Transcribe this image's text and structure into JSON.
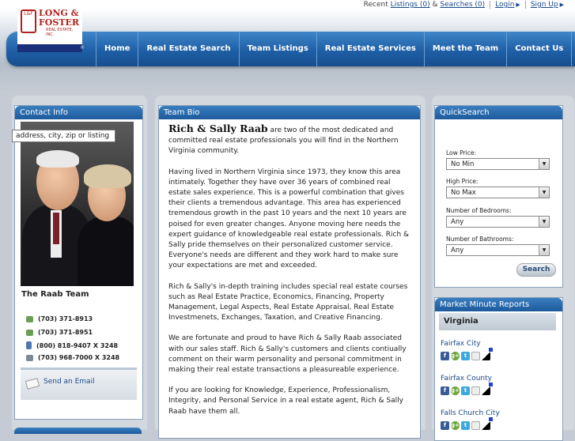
{
  "header": {
    "top_links": {
      "recent_label": "Recent",
      "listings": "Listings (0)",
      "amp": "&",
      "searches": "Searches (0)",
      "login": "Login",
      "signup": "Sign Up"
    },
    "logo": {
      "line1": "LONG &",
      "line2": "FOSTER",
      "line3": "REAL ESTATE, INC.",
      "seal": "L&F",
      "registered": "®"
    },
    "nav": [
      "Home",
      "Real Estate Search",
      "Team Listings",
      "Real Estate Services",
      "Meet the Team",
      "Contact Us"
    ]
  },
  "contact": {
    "title": "Contact Info",
    "team_name": "The Raab Team",
    "phones": [
      "(703) 371-8913",
      "(703) 371-8951",
      "(800) 818-9407 X 3248",
      "(703) 968-7000 X 3248"
    ],
    "email_link": "Send an Email"
  },
  "bio": {
    "title": "Team Bio",
    "name": "Rich & Sally Raab",
    "intro_rest": " are two of the most dedicated and committed real estate professionals you will find in the Northern Virginia community.",
    "paragraphs": [
      "Having lived in Northern Virginia since 1973, they know this area intimately. Together they have over 36 years of combined real estate sales experience. This is a powerful combination that gives their clients a tremendous advantage. This area has experienced tremendous growth in the past 10 years and the next 10 years are poised for even greater changes. Anyone moving here needs the expert guidance of knowledgeable real estate professionals. Rich & Sally pride themselves on their personalized customer service. Everyone's needs are different and they work hard to make sure your expectations are met and exceeded.",
      "Rich & Sally's in-depth training includes special real estate courses such as Real Estate Practice, Economics, Financing, Property Management, Legal Aspects, Real Estate Appraisal, Real Estate Investmenets, Exchanges, Taxation, and Creative Financing.",
      "We are fortunate and proud to have Rich & Sally Raab associated with our sales staff. Rich & Sally's customers and clients contiually comment on their warm personality and personal commitment in making their real estate transactions a pleasureable experience.",
      "If you are looking for Knowledge, Experience, Professionalism, Integrity, and Personal Service in a real estate agent, Rich & Sally Raab have them all."
    ]
  },
  "quicksearch": {
    "title": "QuickSearch",
    "input_value": "address, city, zip or listing #",
    "low_price_label": "Low Price:",
    "low_price_value": "No Min",
    "high_price_label": "High Price:",
    "high_price_value": "No Max",
    "bedrooms_label": "Number of Bedrooms:",
    "bedrooms_value": "Any",
    "bathrooms_label": "Number of Bathrooms:",
    "bathrooms_value": "Any",
    "button": "Search"
  },
  "market": {
    "title": "Market Minute Reports",
    "state": "Virginia",
    "cities": [
      "Fairfax City",
      "Fairfax County",
      "Falls Church City"
    ],
    "share_icons": {
      "facebook": "f",
      "google_plus": "g+",
      "twitter": "t"
    }
  }
}
